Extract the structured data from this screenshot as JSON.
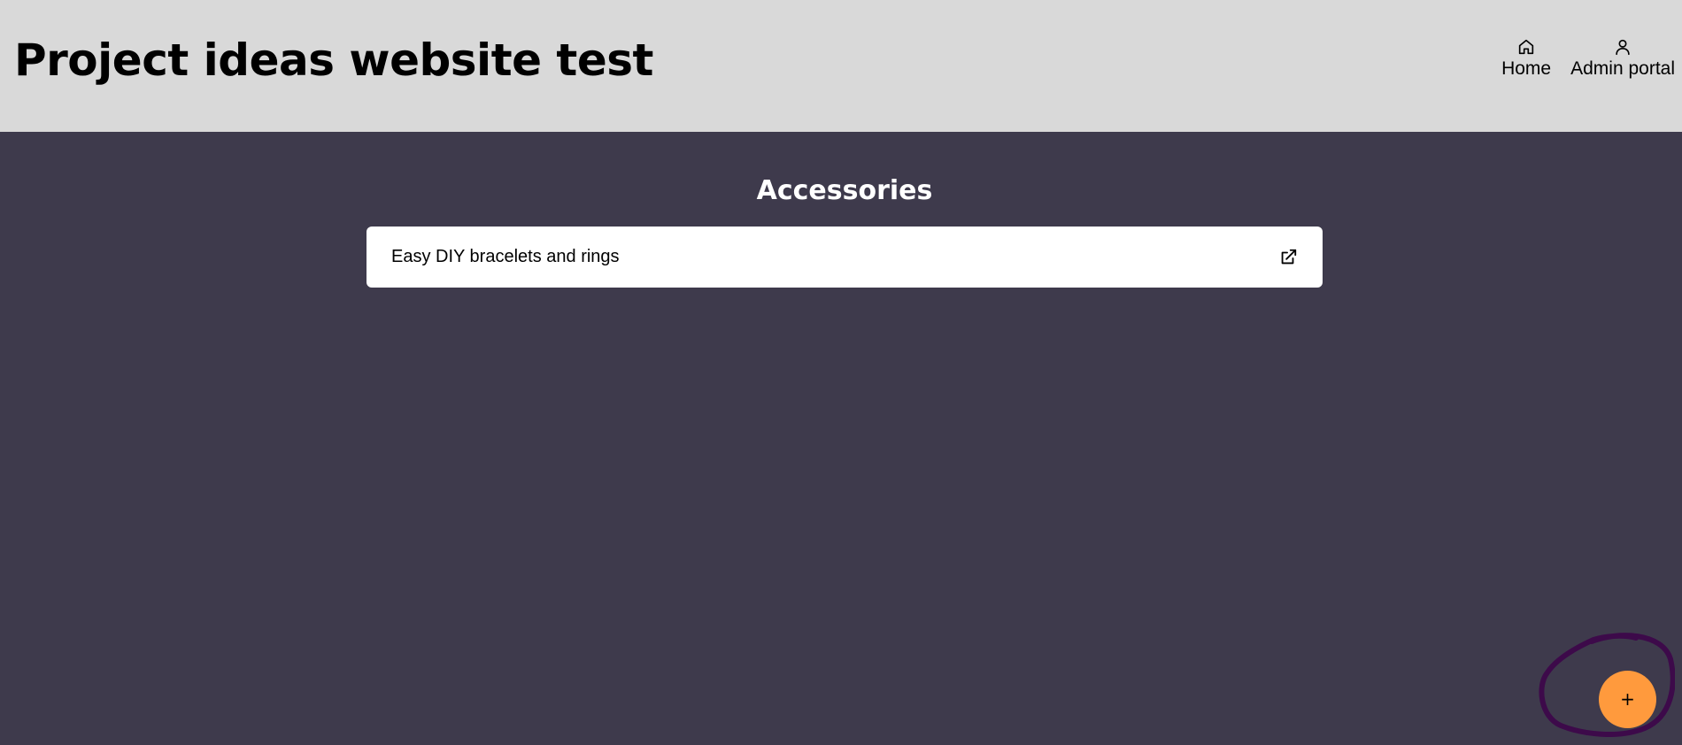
{
  "header": {
    "title": "Project ideas website test",
    "nav": [
      {
        "label": "Home",
        "icon": "home-icon"
      },
      {
        "label": "Admin portal",
        "icon": "user-icon"
      }
    ]
  },
  "main": {
    "section_heading": "Accessories",
    "items": [
      {
        "label": "Easy DIY bracelets and rings",
        "icon": "external-link-icon"
      }
    ]
  },
  "fab": {
    "label": "+",
    "color": "#ff9a3d",
    "annotation_color": "#3d0a4a"
  },
  "colors": {
    "header_bg": "#d9d9d9",
    "main_bg": "#3e3a4c",
    "card_bg": "#ffffff"
  }
}
